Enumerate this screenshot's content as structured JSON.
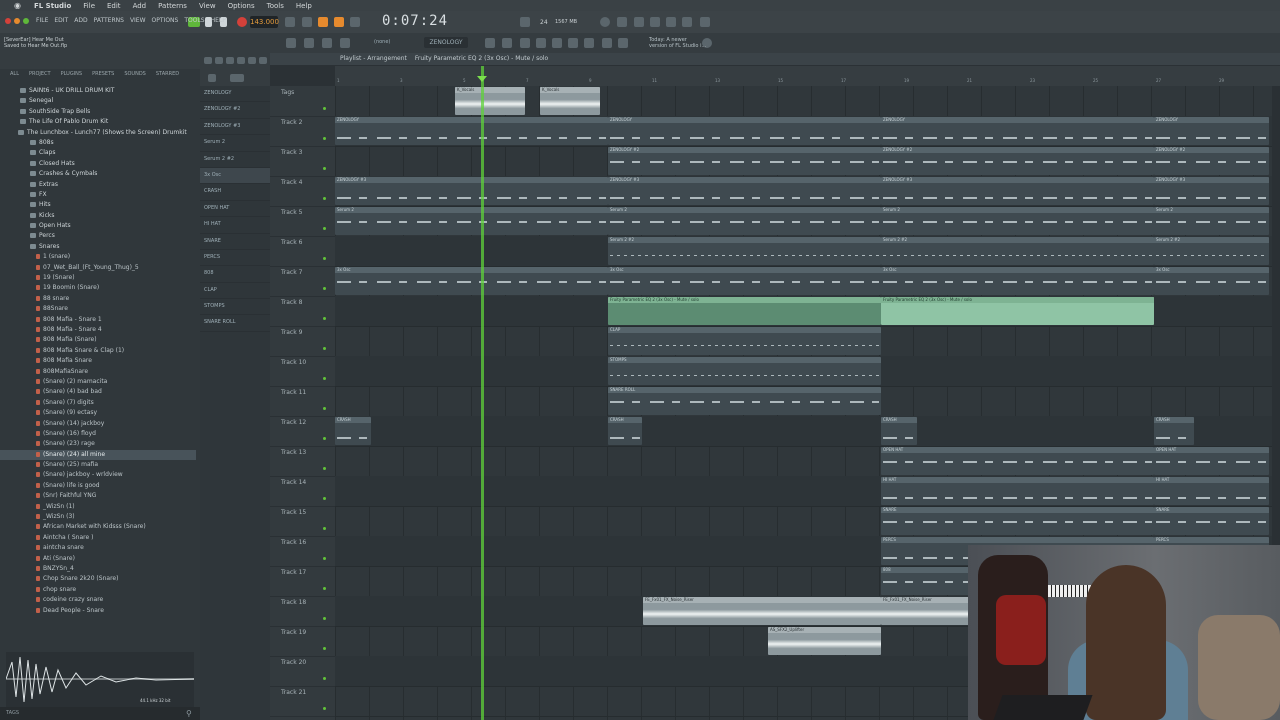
{
  "menubar": {
    "app_name": "FL Studio",
    "items": [
      "File",
      "Edit",
      "Add",
      "Patterns",
      "View",
      "Options",
      "Tools",
      "Help"
    ]
  },
  "transport": {
    "menu_items": [
      "FILE",
      "EDIT",
      "ADD",
      "PATTERNS",
      "VIEW",
      "OPTIONS",
      "TOOLS",
      "HELP"
    ],
    "time": "0:07:24",
    "tempo": "143.000",
    "pattern": "ZENOLOGY",
    "snap": "(none)",
    "cpu": "24",
    "memory": "1567 MB",
    "hint_line1": "Today: A newer",
    "hint_line2": "version of FL Studio i..."
  },
  "project_info": {
    "line1": "[SeverEar] Hear Me Out",
    "line2": "Saved to Hear Me Out.flp"
  },
  "browser": {
    "tabs": [
      "ALL",
      "PROJECT",
      "PLUGINS",
      "PRESETS",
      "SOUNDS",
      "STARRED"
    ],
    "items": [
      {
        "label": "SAINt6 - UK DRILL DRUM KIT",
        "type": "folder"
      },
      {
        "label": "Senegal",
        "type": "folder"
      },
      {
        "label": "SouthSide Trap Bells",
        "type": "folder"
      },
      {
        "label": "The Life Of Pablo Drum Kit",
        "type": "folder"
      },
      {
        "label": "The Lunchbox - Lunch77 (Shows the Screen) Drumkit",
        "type": "folder"
      },
      {
        "label": "808s",
        "type": "folder"
      },
      {
        "label": "Claps",
        "type": "folder"
      },
      {
        "label": "Closed Hats",
        "type": "folder"
      },
      {
        "label": "Crashes & Cymbals",
        "type": "folder"
      },
      {
        "label": "Extras",
        "type": "folder"
      },
      {
        "label": "FX",
        "type": "folder"
      },
      {
        "label": "Hits",
        "type": "folder"
      },
      {
        "label": "Kicks",
        "type": "folder"
      },
      {
        "label": "Open Hats",
        "type": "folder"
      },
      {
        "label": "Percs",
        "type": "folder"
      },
      {
        "label": "Snares",
        "type": "folder"
      },
      {
        "label": "1 (snare)",
        "type": "file"
      },
      {
        "label": "07_Wet_Ball_(Ft_Young_Thug)_5",
        "type": "file"
      },
      {
        "label": "19 (Snare)",
        "type": "file"
      },
      {
        "label": "19 Boomin (Snare)",
        "type": "file"
      },
      {
        "label": "88 snare",
        "type": "file"
      },
      {
        "label": "88Snare",
        "type": "file"
      },
      {
        "label": "808 Mafia - Snare 1",
        "type": "file"
      },
      {
        "label": "808 Mafia - Snare 4",
        "type": "file"
      },
      {
        "label": "808 Mafia (Snare)",
        "type": "file"
      },
      {
        "label": "808 Mafia Snare & Clap (1)",
        "type": "file"
      },
      {
        "label": "808 Mafia Snare",
        "type": "file"
      },
      {
        "label": "808MafiaSnare",
        "type": "file"
      },
      {
        "label": "(Snare) (2) mamacita",
        "type": "file"
      },
      {
        "label": "(Snare) (4) bad bad",
        "type": "file"
      },
      {
        "label": "(Snare) (7) digits",
        "type": "file"
      },
      {
        "label": "(Snare) (9) ectasy",
        "type": "file"
      },
      {
        "label": "(Snare) (14) jackboy",
        "type": "file"
      },
      {
        "label": "(Snare) (16) floyd",
        "type": "file"
      },
      {
        "label": "(Snare) (23) rage",
        "type": "file"
      },
      {
        "label": "(Snare) (24) all mine",
        "type": "file",
        "selected": true
      },
      {
        "label": "(Snare) (25) mafia",
        "type": "file"
      },
      {
        "label": "(Snare) jackboy - wrldview",
        "type": "file"
      },
      {
        "label": "(Snare) life is good",
        "type": "file"
      },
      {
        "label": "(Snr) Faithful YNG",
        "type": "file"
      },
      {
        "label": "_WizSn (1)",
        "type": "file"
      },
      {
        "label": "_WizSn (3)",
        "type": "file"
      },
      {
        "label": "African Market with Kidsss (Snare)",
        "type": "file"
      },
      {
        "label": "Aintcha ( Snare )",
        "type": "file"
      },
      {
        "label": "aintcha snare",
        "type": "file"
      },
      {
        "label": "Ati (Snare)",
        "type": "file"
      },
      {
        "label": "BNZYSn_4",
        "type": "file"
      },
      {
        "label": "Chop Snare 2k20 (Snare)",
        "type": "file"
      },
      {
        "label": "chop snare",
        "type": "file"
      },
      {
        "label": "codeine crazy snare",
        "type": "file"
      },
      {
        "label": "Dead People - Snare",
        "type": "file"
      }
    ],
    "footer": "TAGS",
    "sample_info": "44.1 kHz 32 bit"
  },
  "picker": {
    "items": [
      "ZENOLOGY",
      "ZENOLOGY #2",
      "ZENOLOGY #3",
      "Serum 2",
      "Serum 2 #2",
      "3x Osc",
      "CRASH",
      "OPEN HAT",
      "HI HAT",
      "SNARE",
      "PERCS",
      "808",
      "CLAP",
      "STOMPS",
      "SNARE ROLL"
    ],
    "selected": "3x Osc"
  },
  "playlist": {
    "title": "Playlist - Arrangement",
    "breadcrumb": "Fruity Parametric EQ 2 (3x Osc) - Mute / solo",
    "tracks": [
      "Tags",
      "Track 2",
      "Track 3",
      "Track 4",
      "Track 5",
      "Track 6",
      "Track 7",
      "Track 8",
      "Track 9",
      "Track 10",
      "Track 11",
      "Track 12",
      "Track 13",
      "Track 14",
      "Track 15",
      "Track 16",
      "Track 17",
      "Track 18",
      "Track 19",
      "Track 20",
      "Track 21"
    ],
    "bars": [
      "1",
      "3",
      "5",
      "7",
      "9",
      "11",
      "13",
      "15",
      "17",
      "19",
      "21",
      "23",
      "25",
      "27",
      "29"
    ],
    "clips": [
      {
        "track": 0,
        "label": "K_Vocals",
        "type": "audio"
      },
      {
        "track": 1,
        "label": "ZENOLOGY",
        "type": "pattern"
      },
      {
        "track": 2,
        "label": "ZENOLOGY #2",
        "type": "pattern"
      },
      {
        "track": 3,
        "label": "ZENOLOGY #3",
        "type": "pattern"
      },
      {
        "track": 4,
        "label": "Serum 2",
        "type": "pattern"
      },
      {
        "track": 5,
        "label": "Serum 2 #2",
        "type": "pattern"
      },
      {
        "track": 6,
        "label": "3x Osc",
        "type": "pattern"
      },
      {
        "track": 7,
        "label": "Fruity Parametric EQ 2 (3x Osc) - Mute / solo",
        "type": "automation"
      },
      {
        "track": 8,
        "label": "CLAP",
        "type": "pattern"
      },
      {
        "track": 9,
        "label": "STOMPS",
        "type": "pattern"
      },
      {
        "track": 10,
        "label": "SNARE ROLL",
        "type": "pattern"
      },
      {
        "track": 11,
        "label": "CRASH",
        "type": "pattern"
      },
      {
        "track": 12,
        "label": "OPEN HAT",
        "type": "pattern"
      },
      {
        "track": 13,
        "label": "HI HAT",
        "type": "pattern"
      },
      {
        "track": 14,
        "label": "SNARE",
        "type": "pattern"
      },
      {
        "track": 15,
        "label": "PERCS",
        "type": "pattern"
      },
      {
        "track": 16,
        "label": "808",
        "type": "pattern"
      },
      {
        "track": 17,
        "label": "FE_Fx01_FX_Noise_Riser",
        "type": "audio"
      },
      {
        "track": 18,
        "label": "AS_SFX2_Uplifter",
        "type": "audio"
      }
    ]
  },
  "colors": {
    "accent": "#e68a2e",
    "playhead": "#5fd13a",
    "automation": "#7eb393"
  }
}
